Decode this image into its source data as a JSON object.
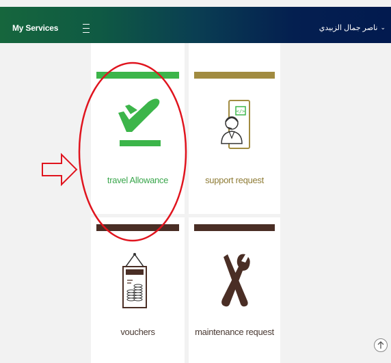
{
  "header": {
    "app_title": "My Services",
    "user_name": "ناصر جمال الزبيدي",
    "user_chevron": "⌄"
  },
  "services": [
    {
      "label": "travel Allowance",
      "icon": "plane-takeoff-icon",
      "accent": "#3cb54a"
    },
    {
      "label": "support request",
      "icon": "support-agent-icon",
      "accent": "#a18b40"
    },
    {
      "label": "vouchers",
      "icon": "voucher-board-icon",
      "accent": "#4a2e25"
    },
    {
      "label": "maintenance request",
      "icon": "tools-icon",
      "accent": "#4a2e25"
    }
  ],
  "annotations": {
    "highlight_color": "#e0141e"
  }
}
